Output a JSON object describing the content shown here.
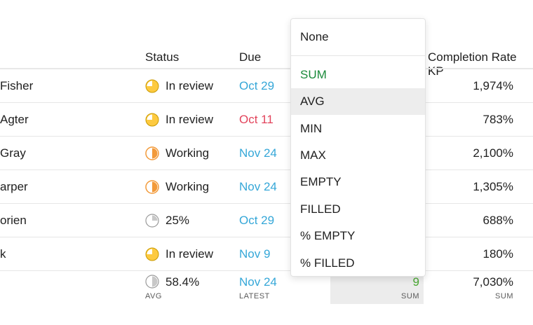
{
  "header": {
    "status": "Status",
    "due": "Due",
    "completion_rate": "Completion Rate KP"
  },
  "rows": [
    {
      "name": "Fisher",
      "status": "In review",
      "status_icon": "half-circle-yellow-icon",
      "due": "Oct 29",
      "due_color": "#35a7d8",
      "rate": "1,974%"
    },
    {
      "name": "Agter",
      "status": "In review",
      "status_icon": "half-circle-yellow-icon",
      "due": "Oct 11",
      "due_color": "#e2445c",
      "rate": "783%"
    },
    {
      "name": "Gray",
      "status": "Working",
      "status_icon": "half-circle-orange-icon",
      "due": "Nov 24",
      "due_color": "#35a7d8",
      "rate": "2,100%"
    },
    {
      "name": "arper",
      "status": "Working",
      "status_icon": "half-circle-orange-icon",
      "due": "Nov 24",
      "due_color": "#35a7d8",
      "rate": "1,305%"
    },
    {
      "name": "orien",
      "status": "25%",
      "status_icon": "quarter-circle-gray-icon",
      "due": "Oct 29",
      "due_color": "#35a7d8",
      "rate": "688%"
    },
    {
      "name": "k",
      "status": "In review",
      "status_icon": "half-circle-yellow-icon",
      "due": "Nov 9",
      "due_color": "#35a7d8",
      "rate": "180%"
    }
  ],
  "summary": {
    "status_value": "58.4%",
    "status_label": "AVG",
    "due_value": "Nov 24",
    "due_label": "LATEST",
    "count_value": "9",
    "count_label": "SUM",
    "rate_value": "7,030%",
    "rate_label": "SUM"
  },
  "dropdown": {
    "none": "None",
    "items": [
      "SUM",
      "AVG",
      "MIN",
      "MAX",
      "EMPTY",
      "FILLED",
      "% EMPTY",
      "% FILLED"
    ],
    "selected": "SUM",
    "hovered": "AVG"
  },
  "colors": {
    "blue": "#35a7d8",
    "red": "#e2445c",
    "green": "#1a8a3a",
    "yellow": "#fdca40",
    "orange": "#f29a3a",
    "gray": "#c8c8c8"
  }
}
